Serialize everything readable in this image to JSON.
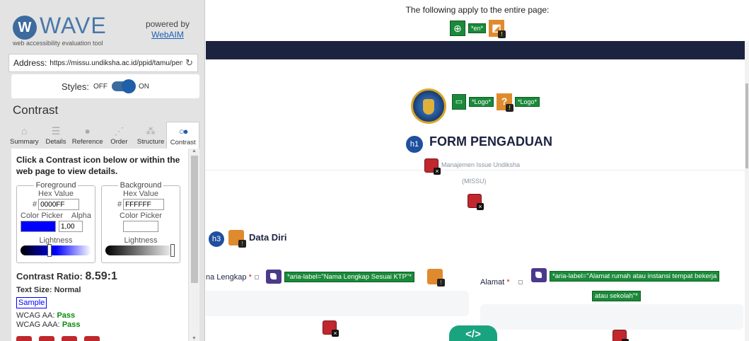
{
  "sidebar": {
    "brand_name": "WAVE",
    "brand_logo_letter": "W",
    "brand_subtitle": "web accessibility evaluation tool",
    "powered_by": "powered by",
    "powered_link": "WebAIM",
    "address_label": "Address:",
    "address_value": "https://missu.undiksha.ac.id/ppid/tamu/pen",
    "styles_label": "Styles:",
    "styles_off": "OFF",
    "styles_on": "ON",
    "section_title": "Contrast",
    "tabs": [
      {
        "label": "Summary",
        "icon": "home-icon"
      },
      {
        "label": "Details",
        "icon": "list-icon"
      },
      {
        "label": "Reference",
        "icon": "info-icon"
      },
      {
        "label": "Order",
        "icon": "order-icon"
      },
      {
        "label": "Structure",
        "icon": "structure-icon"
      },
      {
        "label": "Contrast",
        "icon": "contrast-icon",
        "active": true
      }
    ],
    "contrast": {
      "intro": "Click a Contrast icon below or within the web page to view details.",
      "foreground": {
        "legend": "Foreground",
        "hex_label": "Hex Value",
        "hash": "#",
        "hex": "0000FF",
        "color_picker_label": "Color Picker",
        "alpha_label": "Alpha",
        "alpha": "1,00",
        "lightness_label": "Lightness",
        "lightness_level": 0.38,
        "swatch_color": "#0000ff"
      },
      "background": {
        "legend": "Background",
        "hex_label": "Hex Value",
        "hash": "#",
        "hex": "FFFFFF",
        "color_picker_label": "Color Picker",
        "lightness_label": "Lightness",
        "lightness_level": 1.0,
        "swatch_color": "#ffffff"
      },
      "ratio_label": "Contrast Ratio:",
      "ratio_value": "8.59:1",
      "text_size": "Text Size: Normal",
      "sample": "Sample",
      "wcag_aa_label": "WCAG AA:",
      "wcag_aa": "Pass",
      "wcag_aaa_label": "WCAG AAA:",
      "wcag_aaa": "Pass"
    }
  },
  "page": {
    "apply_text": "The following apply to the entire page:",
    "lang_tag": "*en*",
    "logo_tag_1": "*Logo*",
    "logo_tag_2": "*Logo*",
    "h1_badge": "h1",
    "form_title": "FORM PENGADUAN",
    "missu_name": "Manajemen Issue Undiksha",
    "missu_abbr": "(MISSU)",
    "h3_badge": "h3",
    "section_title": "Data Diri",
    "field1_label": "na Lengkap",
    "field1_aria": "*aria-label=\"Nama Lengkap Sesuai KTP\"*",
    "field2_label": "Alamat",
    "field2_aria_line1": "*aria-label=\"Alamat rumah atau instansi tempat bekerja",
    "field2_aria_line2": "atau sekolah\"*",
    "required_mark": "*",
    "code_button": "</>",
    "colors": {
      "navbar": "#1c2340",
      "wave_green": "#1a8a3a",
      "wave_red": "#c0282d",
      "wave_orange": "#e08a2e",
      "wave_purple": "#4b3a8a",
      "heading_badge": "#1f4f9f",
      "code_button": "#1aa37f"
    }
  }
}
